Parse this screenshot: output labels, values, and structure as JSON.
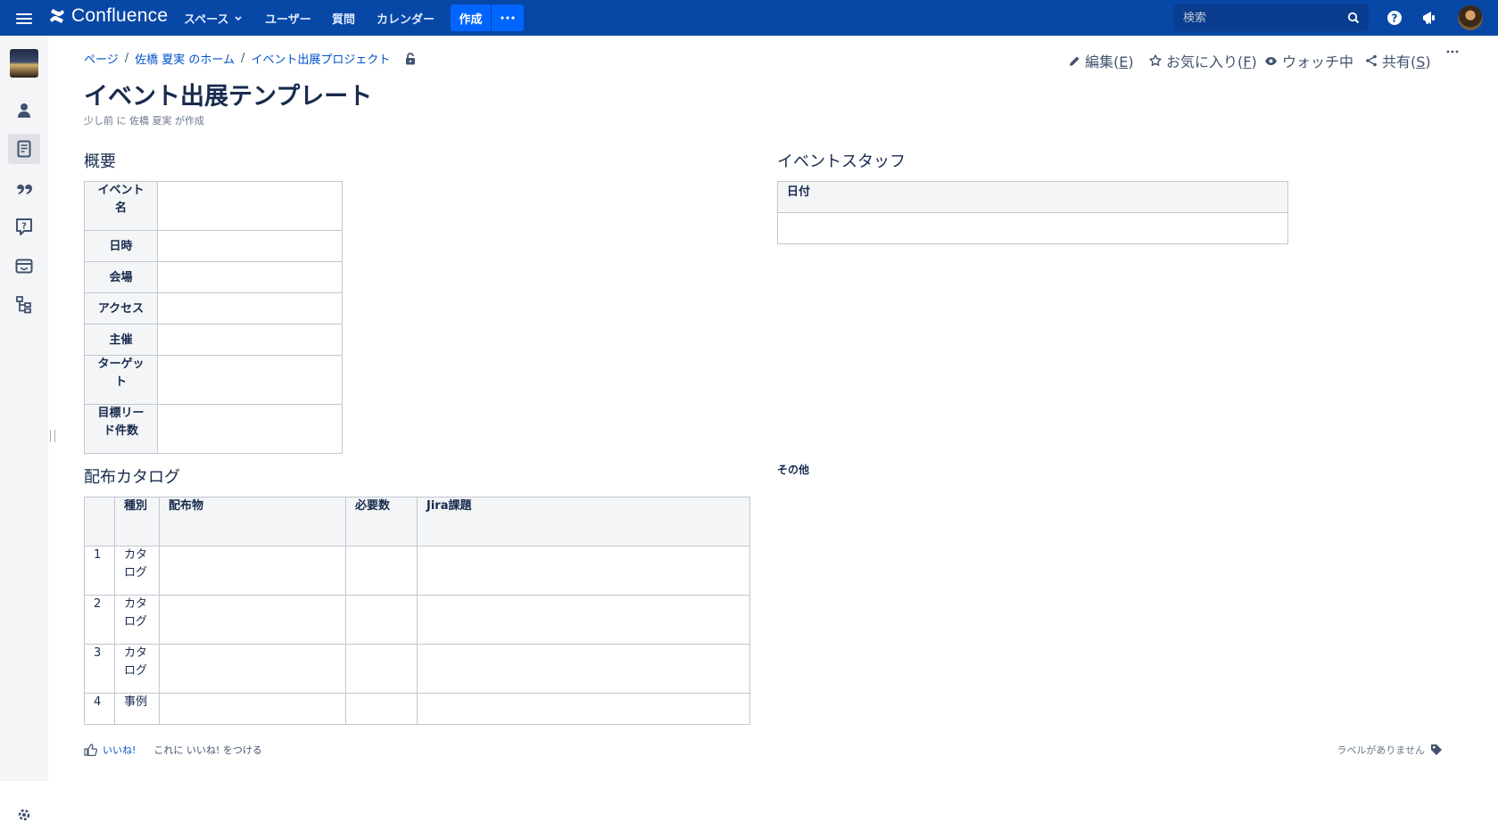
{
  "topbar": {
    "app_name": "Confluence",
    "nav": [
      "スペース",
      "ユーザー",
      "質問",
      "カレンダー"
    ],
    "create_label": "作成",
    "search_placeholder": "検索",
    "brand_color": "#0747a6",
    "create_color": "#0065ff"
  },
  "sidebar": {
    "icons": [
      "space-avatar",
      "user-icon",
      "page-icon",
      "quote-icon",
      "question-icon",
      "calendar-icon",
      "tree-icon",
      "gear-icon"
    ]
  },
  "breadcrumb": [
    "ページ",
    "佐橋 夏実 のホーム",
    "イベント出展プロジェクト"
  ],
  "page_actions": {
    "edit": "編集(",
    "edit_key": "E",
    "favorite": "お気に入り(",
    "favorite_key": "F",
    "watch": "ウォッチ中",
    "share": "共有(",
    "share_key": "S",
    "close_paren": ")"
  },
  "page": {
    "title": "イベント出展テンプレート",
    "byline": "少し前 に 佐橋 夏実 が作成"
  },
  "overview": {
    "heading": "概要",
    "rows": [
      "イベント名",
      "日時",
      "会場",
      "アクセス",
      "主催",
      "ターゲット",
      "目標リード件数"
    ]
  },
  "staff": {
    "heading": "イベントスタッフ",
    "column": "日付"
  },
  "catalog": {
    "heading": "配布カタログ",
    "columns": [
      "",
      "種別",
      "配布物",
      "必要数",
      "Jira課題"
    ],
    "rows": [
      {
        "num": "1",
        "type": "カタログ"
      },
      {
        "num": "2",
        "type": "カタログ"
      },
      {
        "num": "3",
        "type": "カタログ"
      },
      {
        "num": "4",
        "type": "事例"
      }
    ]
  },
  "other": {
    "label": "その他"
  },
  "footer": {
    "like": "いいね!",
    "like_hint": "これに いいね! をつける",
    "labels": "ラベルがありません"
  }
}
